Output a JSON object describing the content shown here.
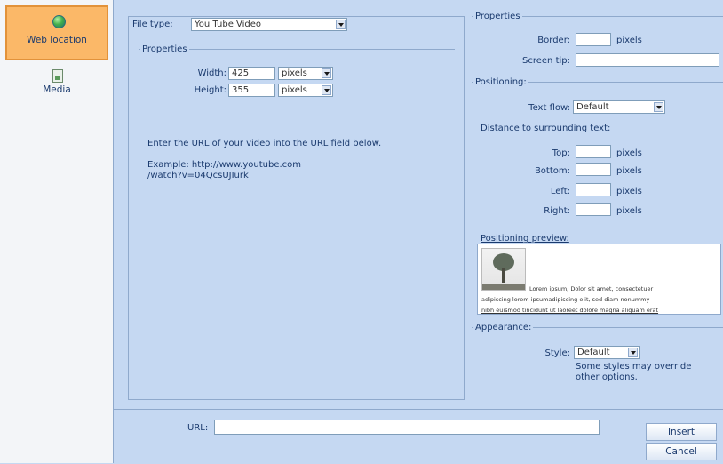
{
  "sidebar": {
    "items": [
      {
        "label": "Web location",
        "icon": "globe-icon",
        "active": true
      },
      {
        "label": "Media",
        "icon": "media-icon",
        "active": false
      }
    ]
  },
  "left_panel": {
    "file_type_label": "File type:",
    "file_type_value": "You Tube Video",
    "properties_legend": "Properties",
    "width_label": "Width:",
    "width_value": "425",
    "width_unit": "pixels",
    "height_label": "Height:",
    "height_value": "355",
    "height_unit": "pixels",
    "instruction": "Enter the URL of your video into the URL field below.",
    "example_line1": "Example: http://www.youtube.com",
    "example_line2": "/watch?v=04QcsUJIurk"
  },
  "right_panel": {
    "properties_legend": "Properties",
    "border_label": "Border:",
    "border_value": "",
    "border_unit": "pixels",
    "screen_tip_label": "Screen tip:",
    "screen_tip_value": "",
    "positioning_legend": "Positioning:",
    "text_flow_label": "Text flow:",
    "text_flow_value": "Default",
    "distance_label": "Distance to surrounding text:",
    "top_label": "Top:",
    "bottom_label": "Bottom:",
    "left_label": "Left:",
    "right_label": "Right:",
    "pixels_unit": "pixels",
    "preview_label": "Positioning preview:",
    "preview_text_line1": "Lorem ipsum, Dolor sit amet, consectetuer",
    "preview_text_line2": "adipiscing lorem ipsumadipiscing elit, sed diam nonummy",
    "preview_text_line3": "nibh euismod tincidunt ut laoreet dolore magna aliquam erat",
    "appearance_legend": "Appearance:",
    "style_label": "Style:",
    "style_value": "Default",
    "style_note_line1": "Some styles may override",
    "style_note_line2": "other options."
  },
  "footer": {
    "url_label": "URL:",
    "url_value": "",
    "insert_label": "Insert",
    "cancel_label": "Cancel"
  },
  "colors": {
    "panel_bg": "#c5d8f2",
    "active_tab": "#fbb868",
    "text": "#1a3a6e"
  }
}
